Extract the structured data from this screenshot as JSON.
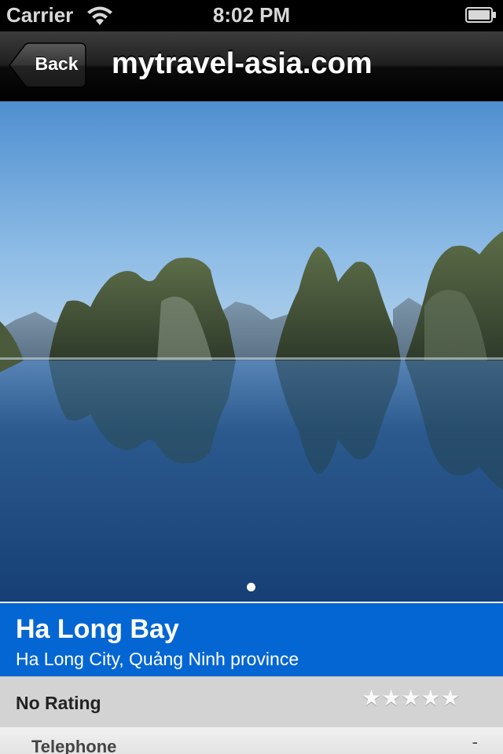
{
  "status_bar": {
    "carrier": "Carrier",
    "time": "8:02 PM",
    "icons": [
      "wifi-icon",
      "battery-icon"
    ]
  },
  "nav": {
    "back_label": "Back",
    "title": "mytravel-asia.com"
  },
  "gallery": {
    "image_subject": "Limestone karst islands reflected in calm bay water",
    "page_indicator": {
      "current": 1,
      "total": 1
    }
  },
  "place": {
    "name": "Ha Long Bay",
    "location": "Ha Long City, Quảng Ninh province"
  },
  "rating": {
    "label": "No Rating",
    "stars_total": 5,
    "stars_filled": 0,
    "stars_text": "★★★★★"
  },
  "details": {
    "telephone_label": "Telephone",
    "telephone_value": "-"
  },
  "colors": {
    "nav_bar": "#1a1a1a",
    "title_block": "#0466d3",
    "rating_row": "#d3d3d3"
  }
}
